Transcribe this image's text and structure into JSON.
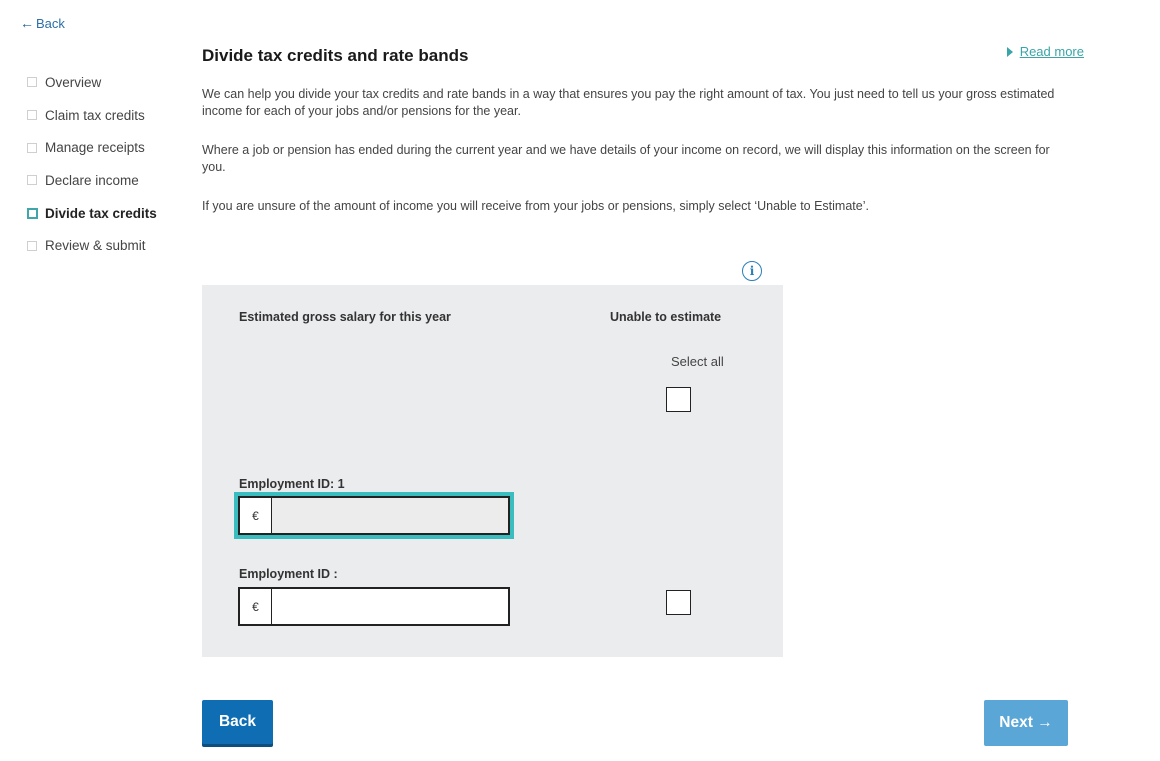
{
  "nav": {
    "back_label": "Back",
    "back_icon": "arrow-left-icon"
  },
  "sidebar": {
    "items": [
      {
        "label": "Overview",
        "active": false
      },
      {
        "label": "Claim tax credits",
        "active": false
      },
      {
        "label": "Manage receipts",
        "active": false
      },
      {
        "label": "Declare income",
        "active": false
      },
      {
        "label": "Divide tax credits",
        "active": true
      },
      {
        "label": "Review & submit",
        "active": false
      }
    ]
  },
  "header": {
    "title": "Divide tax credits and rate bands",
    "read_more": "Read more"
  },
  "intro": {
    "p1": "We can help you divide your tax credits and rate bands in a way that ensures you pay the right amount of tax. You just need to tell us your gross estimated income for each of your jobs and/or pensions for the year.",
    "p2": "Where a job or pension has ended during the current year and we have details of your income on record, we will display this information on the screen for you.",
    "p3": "If you are unsure of the amount of income you will receive from your jobs or pensions, simply select ‘Unable to Estimate’."
  },
  "form": {
    "info_icon": "info-icon",
    "salary_header": "Estimated gross salary for this year",
    "unable_header": "Unable to estimate",
    "select_all_label": "Select all",
    "select_all_checked": false,
    "currency_symbol": "€",
    "employments": [
      {
        "label": "Employment ID: 1",
        "value": "",
        "focused": true,
        "unable_checked": null
      },
      {
        "label": "Employment ID :",
        "value": "",
        "focused": false,
        "unable_checked": false
      }
    ]
  },
  "buttons": {
    "back": "Back",
    "next": "Next →"
  },
  "colors": {
    "primary": "#0f6eb3",
    "primary_disabled": "#5aa6d6",
    "accent_teal": "#3bbcbf",
    "panel_bg": "#ebecee"
  }
}
